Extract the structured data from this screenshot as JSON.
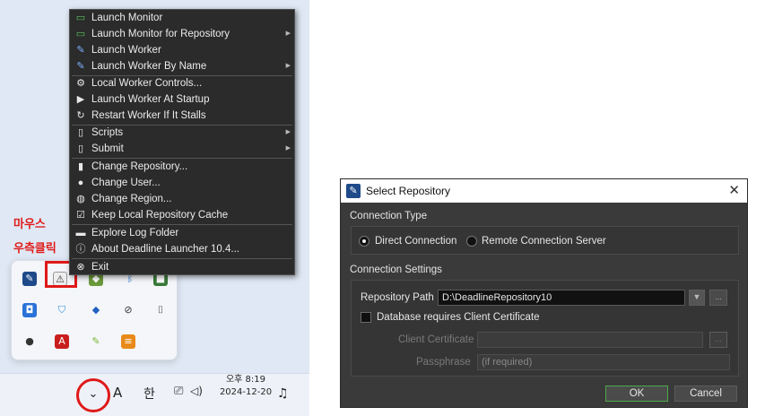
{
  "annotation": {
    "line1": "마우스",
    "line2": "우측클릭"
  },
  "menu": {
    "items": [
      {
        "label": "Launch Monitor",
        "icon": "monitor-icon",
        "submenu": false
      },
      {
        "label": "Launch Monitor for Repository",
        "icon": "monitor-icon",
        "submenu": true
      },
      {
        "label": "Launch Worker",
        "icon": "worker-icon",
        "submenu": false
      },
      {
        "label": "Launch Worker By Name",
        "icon": "worker-icon",
        "submenu": true
      },
      {
        "label": "Local Worker Controls...",
        "icon": "controls-icon",
        "submenu": false
      },
      {
        "label": "Launch Worker At Startup",
        "icon": "play-icon",
        "submenu": false
      },
      {
        "label": "Restart Worker If It Stalls",
        "icon": "restart-icon",
        "submenu": false
      },
      {
        "label": "Scripts",
        "icon": "document-icon",
        "submenu": true
      },
      {
        "label": "Submit",
        "icon": "document-icon",
        "submenu": true
      },
      {
        "label": "Change Repository...",
        "icon": "repository-icon",
        "submenu": false
      },
      {
        "label": "Change User...",
        "icon": "user-icon",
        "submenu": false
      },
      {
        "label": "Change Region...",
        "icon": "globe-icon",
        "submenu": false
      },
      {
        "label": "Keep Local Repository Cache",
        "icon": "checkbox-icon",
        "submenu": false
      },
      {
        "label": "Explore Log Folder",
        "icon": "folder-icon",
        "submenu": false
      },
      {
        "label": "About Deadline Launcher 10.4...",
        "icon": "info-icon",
        "submenu": false
      },
      {
        "label": "Exit",
        "icon": "exit-icon",
        "submenu": false
      }
    ]
  },
  "taskbar": {
    "chevron": "⌄",
    "ime_a": "A",
    "ime_han": "한",
    "clock_line1": "오후 8:19",
    "clock_line2": "2024-12-20"
  },
  "dialog": {
    "title": "Select Repository",
    "close": "✕",
    "connection_type_heading": "Connection Type",
    "radio_direct": "Direct Connection",
    "radio_remote": "Remote Connection Server",
    "connection_settings_heading": "Connection Settings",
    "repo_path_label": "Repository Path",
    "repo_path_value": "D:\\DeadlineRepository10",
    "browse_label": "...",
    "cert_checkbox_label": "Database requires Client Certificate",
    "client_cert_label": "Client Certificate",
    "client_cert_value": "",
    "passphrase_label": "Passphrase",
    "passphrase_placeholder": "(if required)",
    "ok_label": "OK",
    "cancel_label": "Cancel"
  },
  "colors": {
    "annotation_red": "#e01919",
    "menu_bg": "#2b2b2b",
    "dialog_bg": "#3a3a3a",
    "ok_border": "#4ca94c"
  }
}
